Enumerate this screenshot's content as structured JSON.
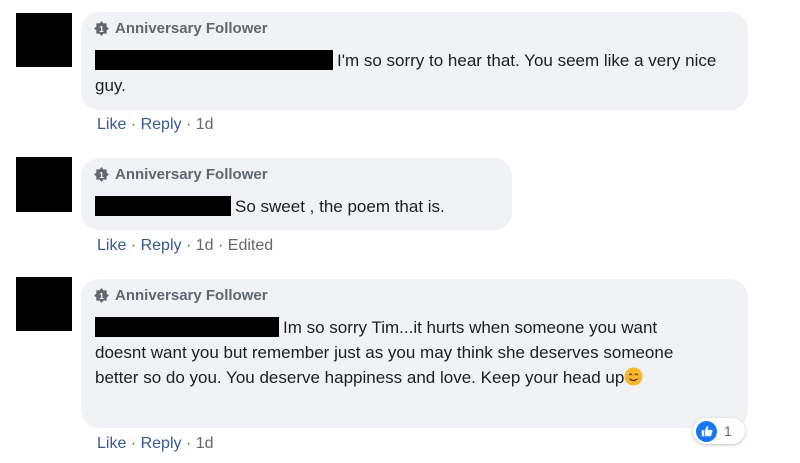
{
  "comments": [
    {
      "badge": "Anniversary Follower",
      "text": "I'm so sorry to hear that. You seem like a very nice guy.",
      "actions": {
        "like": "Like",
        "reply": "Reply",
        "time": "1d"
      }
    },
    {
      "badge": "Anniversary Follower",
      "text": "So sweet , the poem that is.",
      "actions": {
        "like": "Like",
        "reply": "Reply",
        "time": "1d",
        "edited": "Edited"
      }
    },
    {
      "badge": "Anniversary Follower",
      "text": "Im so sorry Tim...it hurts when someone you want doesnt want you but remember just as you may think she deserves someone better so do you. You deserve happiness and love. Keep your head up",
      "emoji": "smiling-face-icon",
      "actions": {
        "like": "Like",
        "reply": "Reply",
        "time": "1d"
      },
      "reaction_count": "1"
    }
  ],
  "separator": "·",
  "colors": {
    "bubble": "#f0f2f5",
    "link": "#385898",
    "meta": "#65676b",
    "like_blue": "#1877f2"
  }
}
